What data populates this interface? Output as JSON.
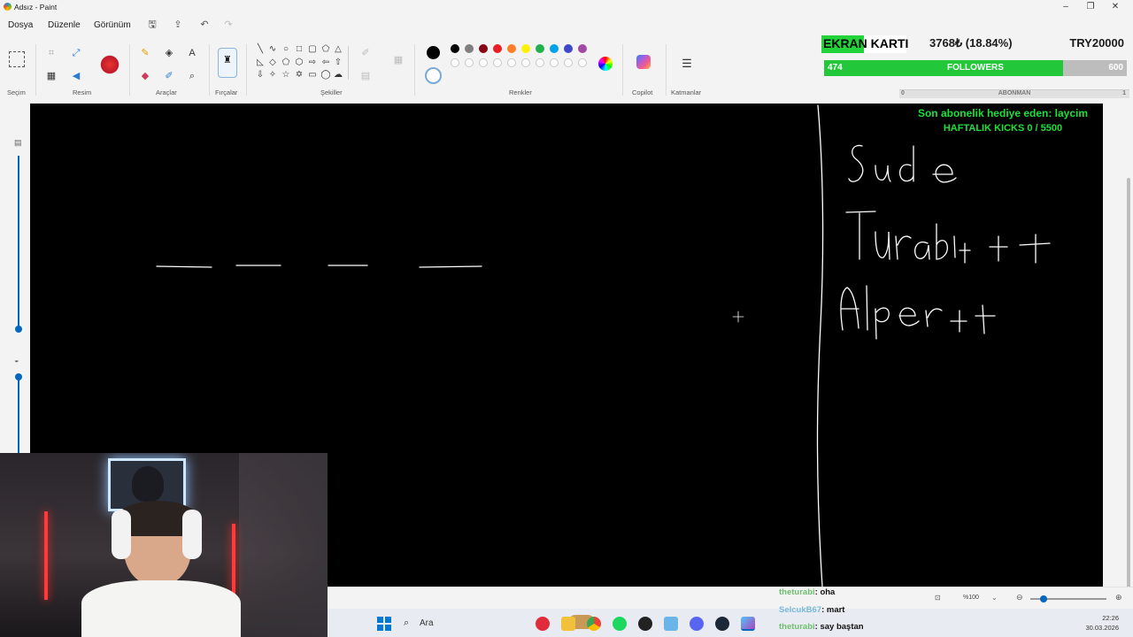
{
  "window": {
    "title": "Adsız - Paint"
  },
  "menu": {
    "items": [
      "Dosya",
      "Düzenle",
      "Görünüm"
    ]
  },
  "ribbon": {
    "groups": {
      "selection": "Seçim",
      "image": "Resim",
      "tools": "Araçlar",
      "brushes": "Fırçalar",
      "shapes": "Şekiller",
      "colors": "Renkler",
      "copilot": "Copilot",
      "layers": "Katmanlar"
    },
    "palette_row1": [
      "#000000",
      "#7f7f7f",
      "#880015",
      "#ed1c24",
      "#ff7f27",
      "#fff200",
      "#22b14c",
      "#00a2e8",
      "#3f48cc",
      "#a349a4"
    ],
    "palette_row2": [
      "#ffffff",
      "#c3c3c3",
      "#b97a57",
      "#ffaec9",
      "#ffc90e",
      "#efe4b0",
      "#b5e61d",
      "#99d9ea",
      "#7092be",
      "#c8bfe7"
    ]
  },
  "overlay": {
    "ekran_label": "EKRAN KARTI",
    "ekran_value": "3768₺ (18.84%)",
    "ekran_goal": "TRY20000",
    "followers_current": "474",
    "followers_label": "FOLLOWERS",
    "followers_goal": "600",
    "followers_fraction": 0.79,
    "abone_start": "0",
    "abone_label": "ABONMAN",
    "abone_end": "1",
    "sub_gift_text": "Son abonelik hediye eden: laycim",
    "kicks_text": "HAFTALIK KICKS 0 / 5500"
  },
  "statusbar": {
    "zoom": "%100"
  },
  "taskbar": {
    "search_placeholder": "Ara",
    "time": "22:26",
    "date": "30.03.2026"
  },
  "chat": [
    {
      "user": "theturabi",
      "sep": ": ",
      "message": "oha"
    },
    {
      "user": "SelcukB67",
      "sep": ": ",
      "message": "mart"
    },
    {
      "user": "theturabi",
      "sep": ": ",
      "message": "say baştan"
    }
  ]
}
